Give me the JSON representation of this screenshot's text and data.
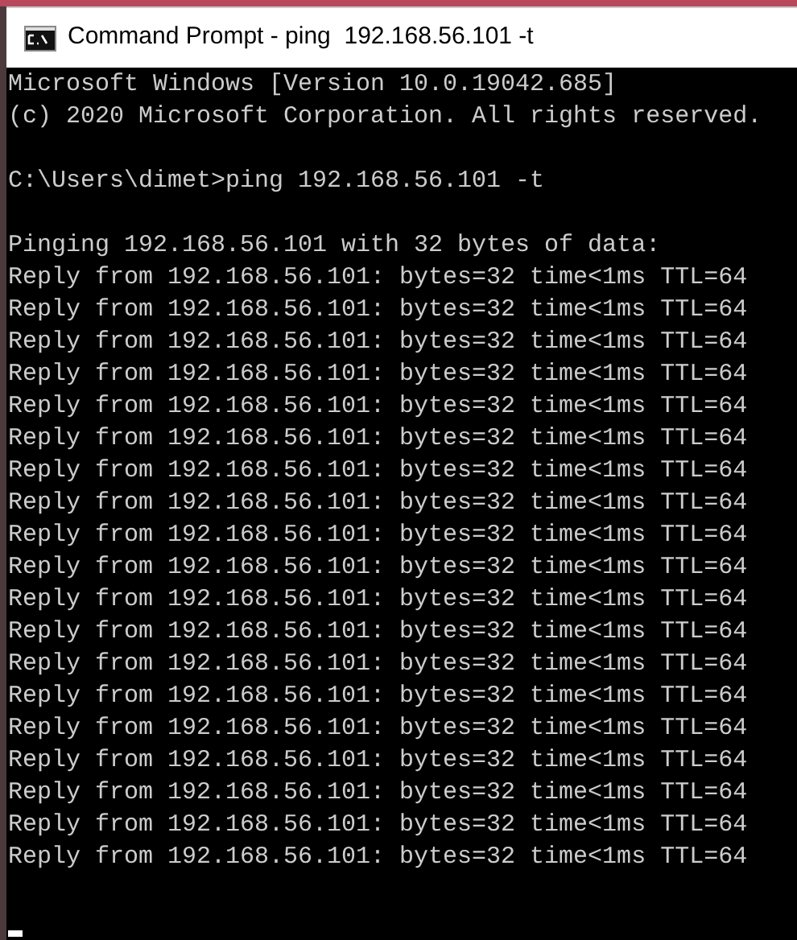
{
  "window": {
    "title": "Command Prompt - ping  192.168.56.101 -t"
  },
  "console": {
    "blocks": [
      [
        "Microsoft Windows [Version 10.0.19042.685]",
        "(c) 2020 Microsoft Corporation. All rights reserved."
      ],
      [
        "C:\\Users\\dimet>ping 192.168.56.101 -t"
      ],
      [
        "Pinging 192.168.56.101 with 32 bytes of data:",
        "Reply from 192.168.56.101: bytes=32 time<1ms TTL=64",
        "Reply from 192.168.56.101: bytes=32 time<1ms TTL=64",
        "Reply from 192.168.56.101: bytes=32 time<1ms TTL=64",
        "Reply from 192.168.56.101: bytes=32 time<1ms TTL=64",
        "Reply from 192.168.56.101: bytes=32 time<1ms TTL=64",
        "Reply from 192.168.56.101: bytes=32 time<1ms TTL=64",
        "Reply from 192.168.56.101: bytes=32 time<1ms TTL=64",
        "Reply from 192.168.56.101: bytes=32 time<1ms TTL=64",
        "Reply from 192.168.56.101: bytes=32 time<1ms TTL=64",
        "Reply from 192.168.56.101: bytes=32 time<1ms TTL=64",
        "Reply from 192.168.56.101: bytes=32 time<1ms TTL=64",
        "Reply from 192.168.56.101: bytes=32 time<1ms TTL=64",
        "Reply from 192.168.56.101: bytes=32 time<1ms TTL=64",
        "Reply from 192.168.56.101: bytes=32 time<1ms TTL=64",
        "Reply from 192.168.56.101: bytes=32 time<1ms TTL=64",
        "Reply from 192.168.56.101: bytes=32 time<1ms TTL=64",
        "Reply from 192.168.56.101: bytes=32 time<1ms TTL=64",
        "Reply from 192.168.56.101: bytes=32 time<1ms TTL=64",
        "Reply from 192.168.56.101: bytes=32 time<1ms TTL=64"
      ]
    ],
    "cursor_visible": true
  }
}
